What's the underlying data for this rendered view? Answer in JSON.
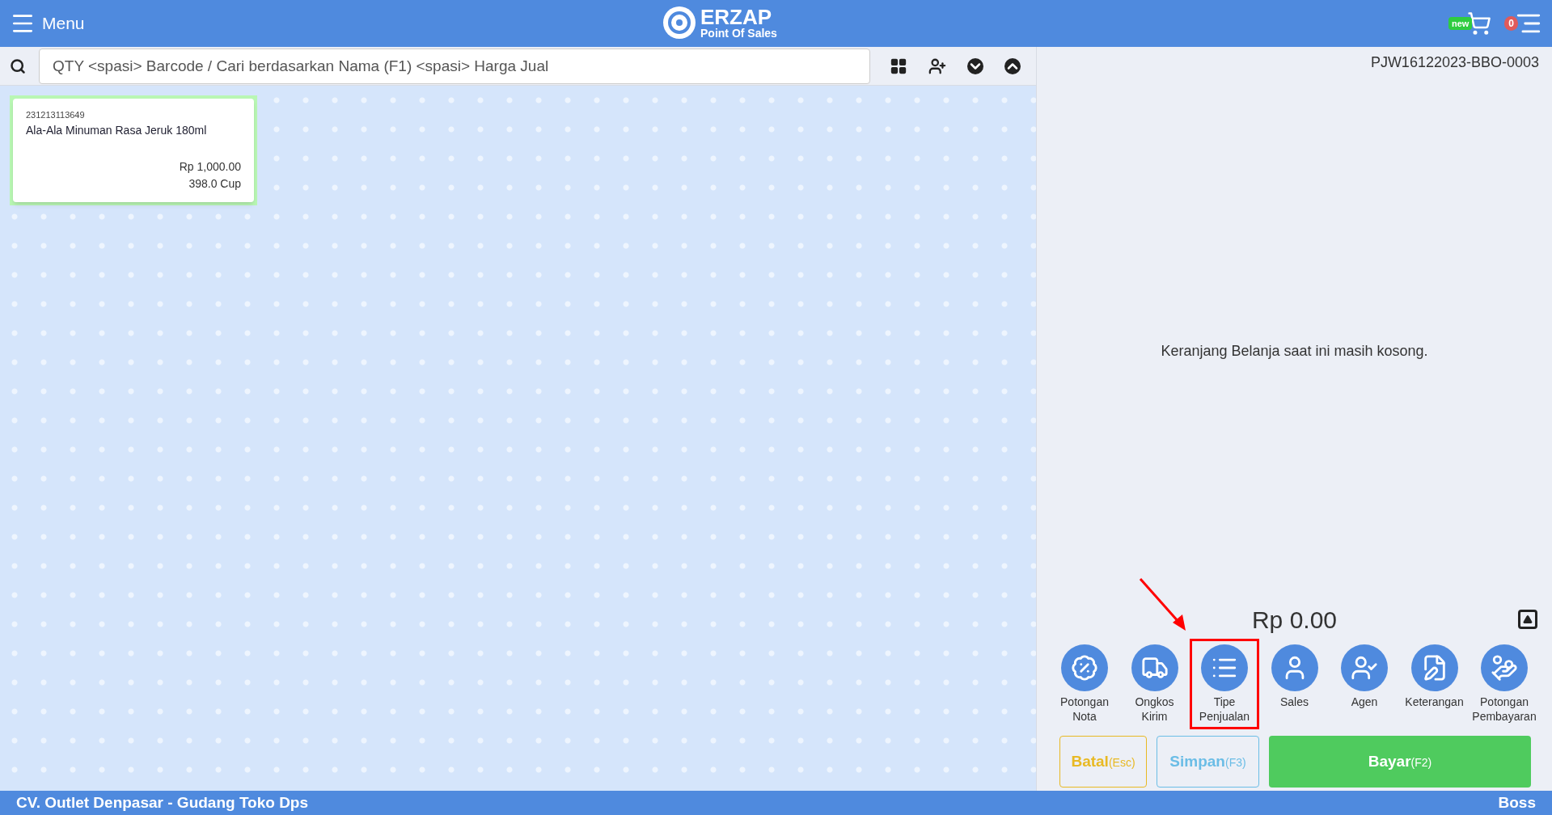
{
  "header": {
    "menu_label": "Menu",
    "logo_title": "ERZAP",
    "logo_subtitle": "Point Of Sales",
    "new_badge": "new",
    "cart_count": "0"
  },
  "search": {
    "placeholder": "QTY <spasi> Barcode / Cari berdasarkan Nama (F1) <spasi> Harga Jual"
  },
  "products": [
    {
      "code": "231213113649",
      "name": "Ala-Ala Minuman Rasa Jeruk 180ml",
      "price": "Rp 1,000.00",
      "stock": "398.0 Cup",
      "selected": true
    }
  ],
  "transaction": {
    "number": "PJW16122023-BBO-0003",
    "empty_message": "Keranjang Belanja saat ini masih kosong.",
    "total": "Rp 0.00"
  },
  "actions": [
    {
      "kind": "discount",
      "label": "Potongan Nota",
      "highlighted": false
    },
    {
      "kind": "shipping",
      "label": "Ongkos Kirim",
      "highlighted": false
    },
    {
      "kind": "sale_type",
      "label": "Tipe Penjualan",
      "highlighted": true
    },
    {
      "kind": "sales",
      "label": "Sales",
      "highlighted": false
    },
    {
      "kind": "agent",
      "label": "Agen",
      "highlighted": false
    },
    {
      "kind": "note",
      "label": "Keterangan",
      "highlighted": false
    },
    {
      "kind": "payment_discount",
      "label": "Potongan Pembayaran",
      "highlighted": false
    }
  ],
  "buttons": [
    {
      "kind": "cancel",
      "label": "Batal",
      "shortcut": "(Esc)"
    },
    {
      "kind": "save",
      "label": "Simpan",
      "shortcut": "(F3)"
    },
    {
      "kind": "pay",
      "label": "Bayar",
      "shortcut": "(F2)"
    }
  ],
  "status_bar": {
    "location": "CV. Outlet Denpasar - Gudang Toko Dps",
    "user": "Boss"
  }
}
